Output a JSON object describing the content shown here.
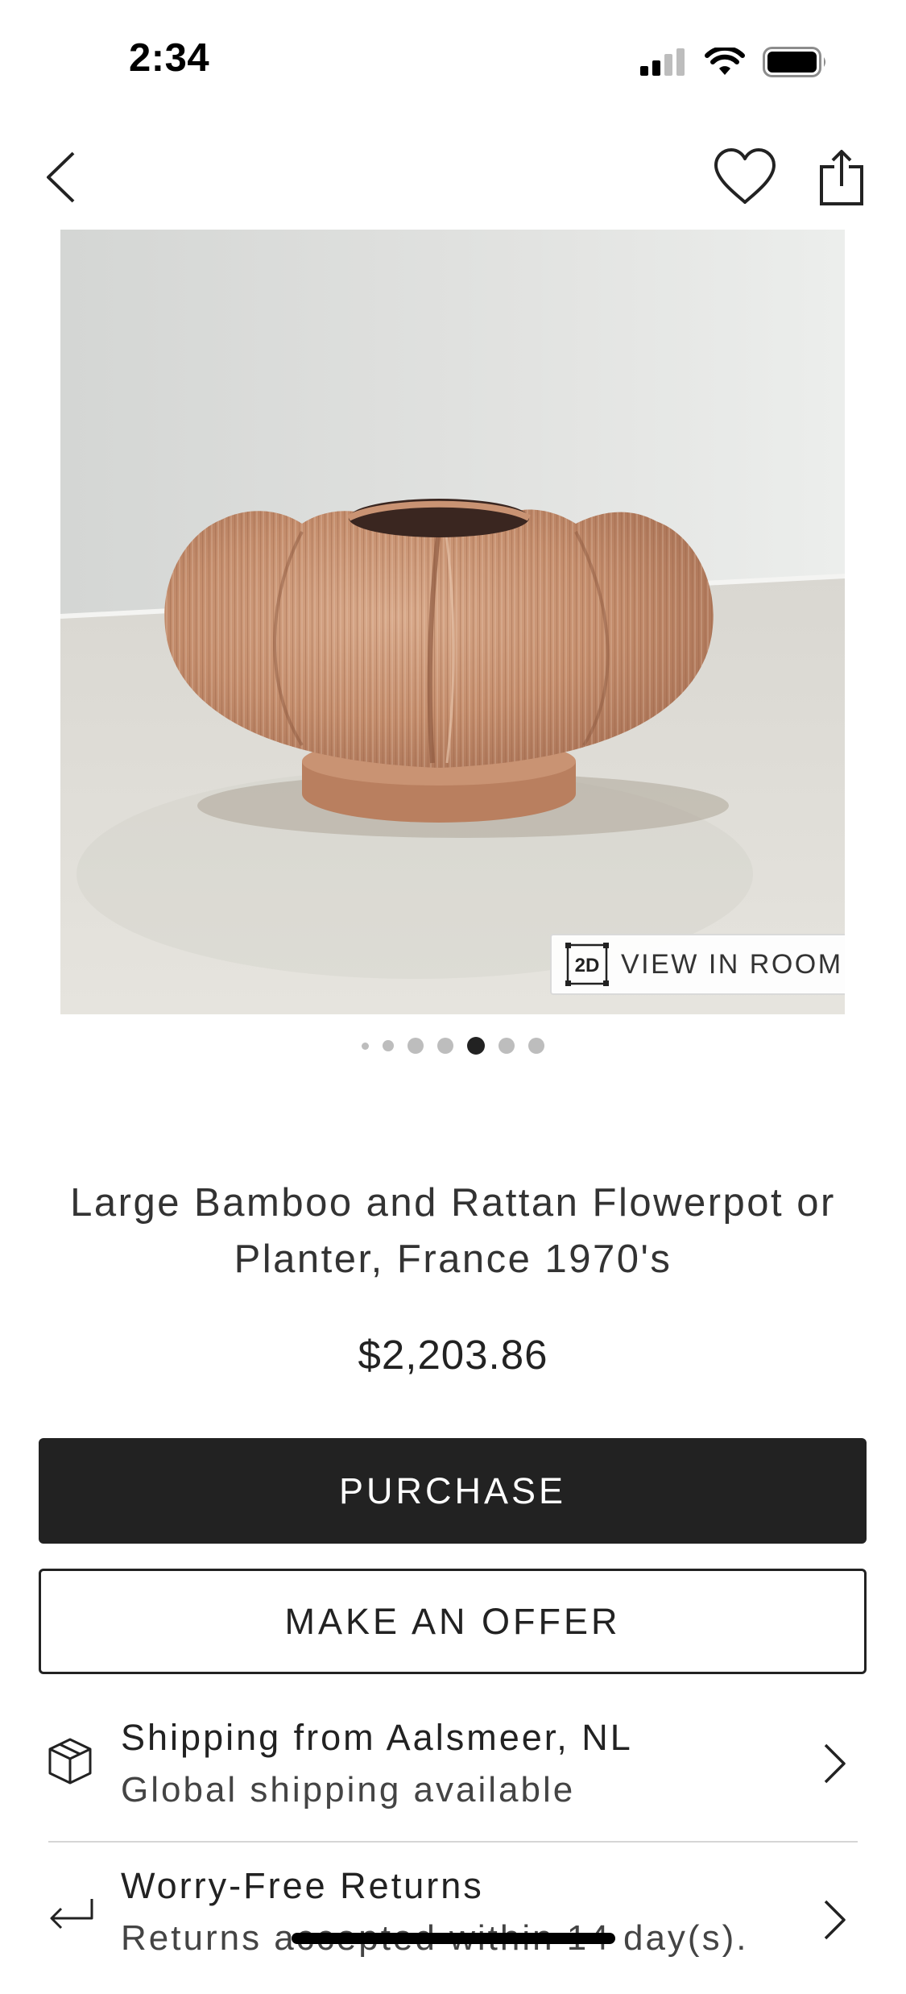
{
  "status_bar": {
    "time": "2:34",
    "icons": [
      "cellular-signal-icon",
      "wifi-icon",
      "battery-icon"
    ]
  },
  "nav": {
    "icons": [
      "chevron-left-icon",
      "heart-icon",
      "share-icon"
    ]
  },
  "gallery": {
    "view_in_room_badge": "2D",
    "view_in_room_label": "VIEW IN ROOM",
    "page_count": 7,
    "active_page_index": 4
  },
  "product": {
    "title": "Large Bamboo and Rattan Flowerpot or Planter, France 1970's",
    "price": "$2,203.86"
  },
  "actions": {
    "purchase_label": "PURCHASE",
    "offer_label": "MAKE AN OFFER"
  },
  "info_rows": [
    {
      "icon": "package-box-icon",
      "title": "Shipping from Aalsmeer, NL",
      "subtitle": "Global shipping available"
    },
    {
      "icon": "return-arrow-icon",
      "title": "Worry-Free Returns",
      "subtitle": "Returns accepted within 14 day(s)."
    }
  ],
  "colors": {
    "primary_button": "#222222",
    "background": "#ffffff",
    "text": "#222222",
    "inactive_dot": "#bdbdbd",
    "active_dot": "#222222"
  }
}
